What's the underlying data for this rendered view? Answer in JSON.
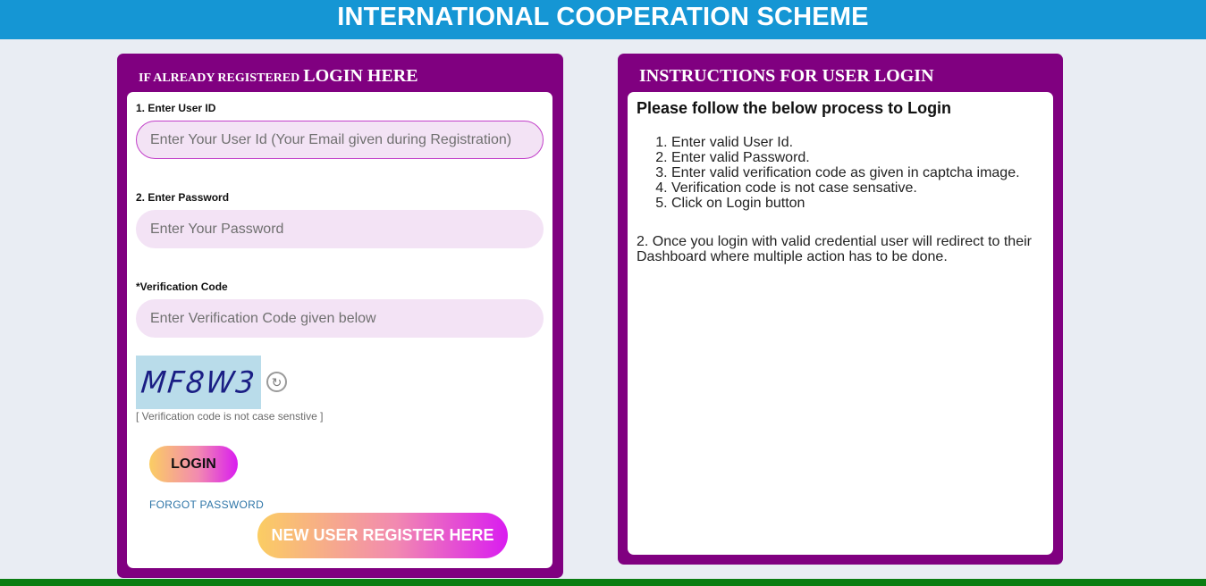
{
  "header": {
    "title": "INTERNATIONAL COOPERATION SCHEME"
  },
  "login_panel": {
    "title_small": "IF ALREADY REGISTERED",
    "title_big": "LOGIN HERE",
    "user_id_label": "1. Enter User ID",
    "user_id_placeholder": "Enter Your User Id (Your Email given during Registration)",
    "password_label": "2. Enter Password",
    "password_placeholder": "Enter Your Password",
    "captcha_label": "*Verification Code",
    "captcha_placeholder": "Enter Verification Code given below",
    "captcha_text": "MF8W3",
    "captcha_hint": "[ Verification code is not case senstive ]",
    "login_button": "LOGIN",
    "forgot_link": "FORGOT PASSWORD",
    "register_button": "NEW USER REGISTER HERE"
  },
  "instructions_panel": {
    "title": "INSTRUCTIONS FOR USER LOGIN",
    "heading": "Please follow the below process to Login",
    "steps": [
      "Enter valid User Id.",
      "Enter valid Password.",
      "Enter valid verification code as given in captcha image.",
      "Verification code is not case sensative.",
      "Click on Login button"
    ],
    "note": "2. Once you login with valid credential user will redirect to their Dashboard where multiple action has to be done."
  },
  "colors": {
    "header_bg": "#1596d4",
    "panel_bg": "#800080",
    "footer_bar": "#0b7d12",
    "input_bg": "#f3e3f5"
  },
  "icons": {
    "refresh": "refresh-icon"
  }
}
